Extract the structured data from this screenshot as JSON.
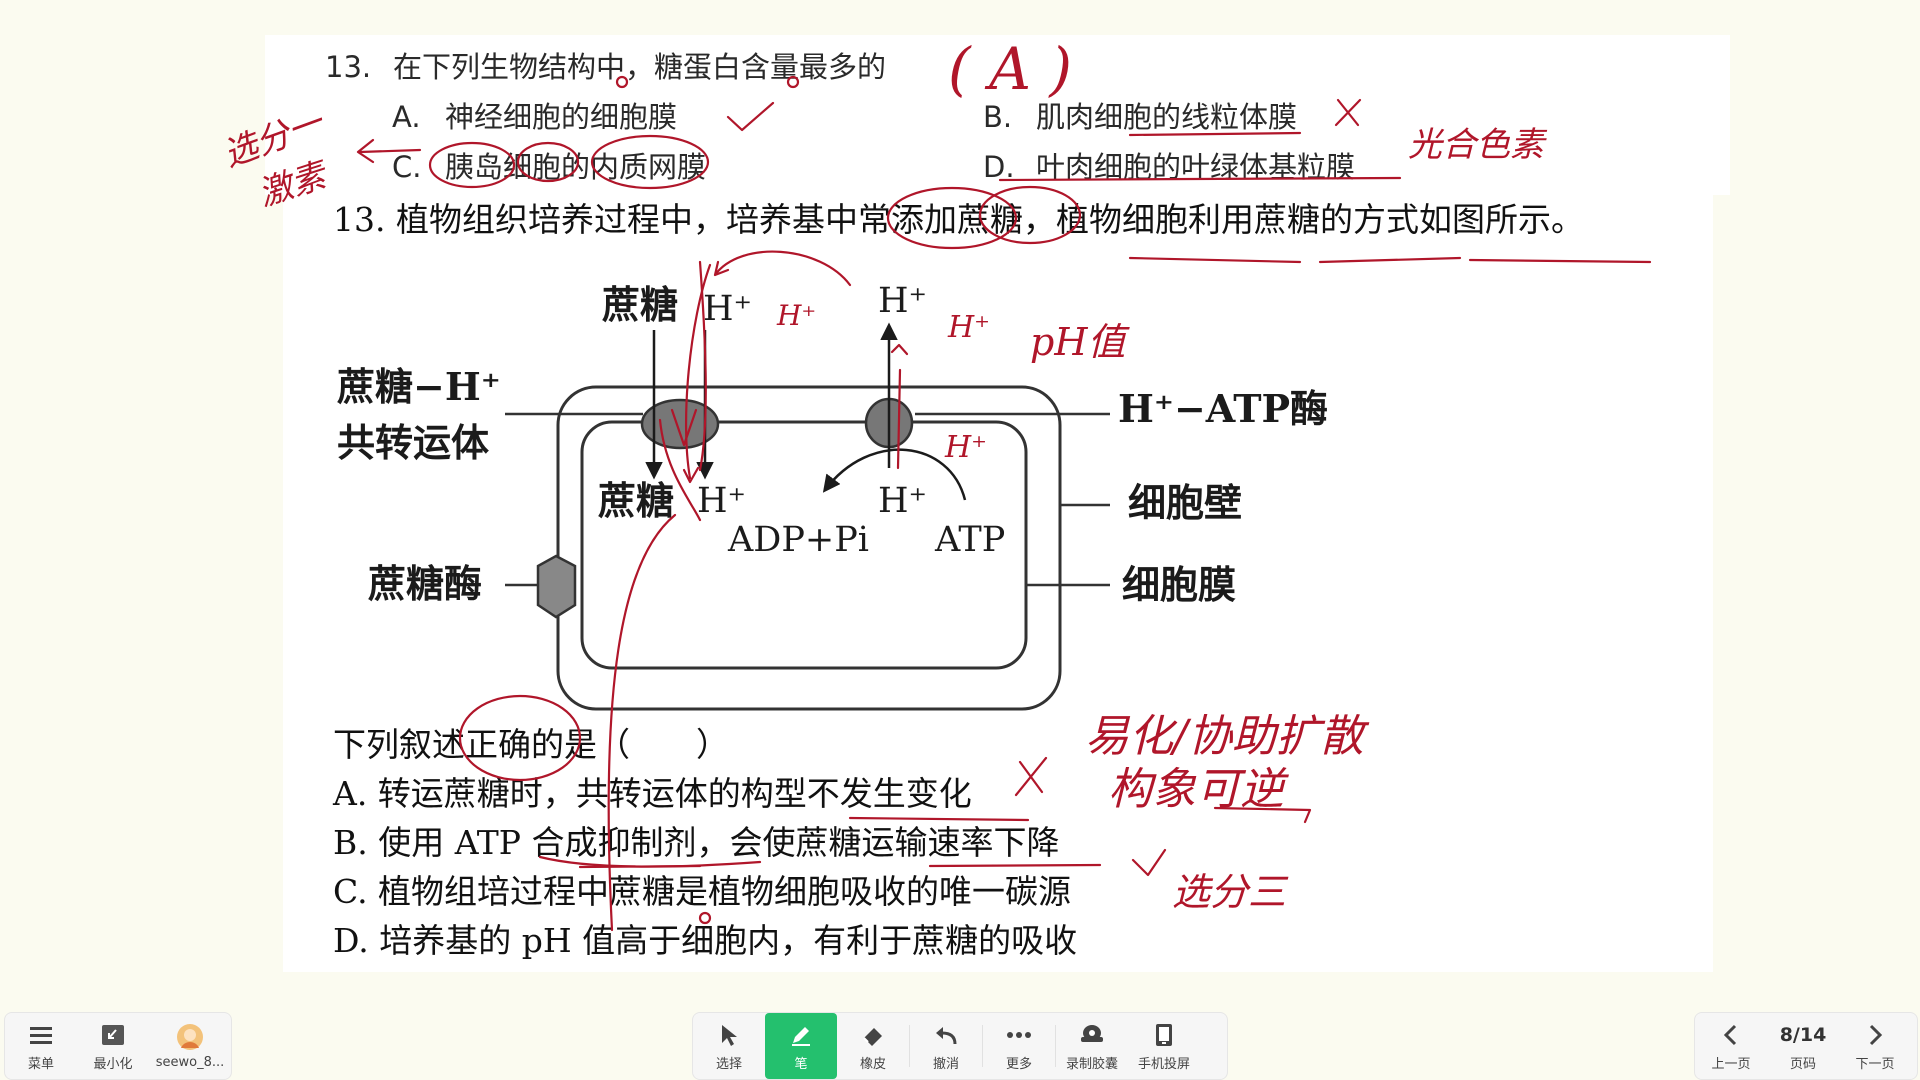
{
  "question1": {
    "stem_prefix": "13.",
    "stem": "在下列生物结构中，糖蛋白含量最多的",
    "options": [
      {
        "key": "A.",
        "text": "神经细胞的细胞膜"
      },
      {
        "key": "B.",
        "text": "肌肉细胞的线粒体膜"
      },
      {
        "key": "C.",
        "text": "胰岛细胞的内质网膜"
      },
      {
        "key": "D.",
        "text": "叶肉细胞的叶绿体基粒膜"
      }
    ]
  },
  "question2": {
    "stem": "13. 植物组织培养过程中，培养基中常添加蔗糖，植物细胞利用蔗糖的方式如图所示。",
    "prompt": "下列叙述正确的是（　　）",
    "options": [
      "A. 转运蔗糖时，共转运体的构型不发生变化",
      "B. 使用 ATP 合成抑制剂，会使蔗糖运输速率下降",
      "C. 植物组培过程中蔗糖是植物细胞吸收的唯一碳源",
      "D. 培养基的 pH 值高于细胞内，有利于蔗糖的吸收"
    ]
  },
  "diagram": {
    "sucrose_top": "蔗糖",
    "h_top_left": "H⁺",
    "h_top_right": "H⁺",
    "cotransporter_line1": "蔗糖−H⁺",
    "cotransporter_line2": "共转运体",
    "atpase": "H⁺−ATP酶",
    "cell_wall": "细胞壁",
    "cell_membrane": "细胞膜",
    "sucrase": "蔗糖酶",
    "sucrose_inside": "蔗糖",
    "h_inside_left": "H⁺",
    "h_inside_right": "H⁺",
    "adp_pi": "ADP+Pi",
    "atp": "ATP"
  },
  "annotations": {
    "answer": "( A )",
    "left_note_1": "选分一",
    "left_note_2": "激素",
    "right_note_1": "光合色素",
    "h_plus_1": "H⁺",
    "h_plus_2": "H⁺",
    "h_plus_3": "H⁺",
    "ph_value": "pH值",
    "note_diffusion": "易化/协助扩散",
    "note_conformation": "构象可逆",
    "note_c": "选分三"
  },
  "toolbar": {
    "menu": "菜单",
    "minimize": "最小化",
    "user": "seewo_8...",
    "select": "选择",
    "pen": "笔",
    "eraser": "橡皮",
    "undo": "撤消",
    "more": "更多",
    "record": "录制胶囊",
    "cast": "手机投屏",
    "prev": "上一页",
    "page": "8/14",
    "page_label": "页码",
    "next": "下一页"
  },
  "colors": {
    "ink": "#b0162a",
    "pen_active": "#24c06e",
    "background": "#fbfbf0"
  }
}
